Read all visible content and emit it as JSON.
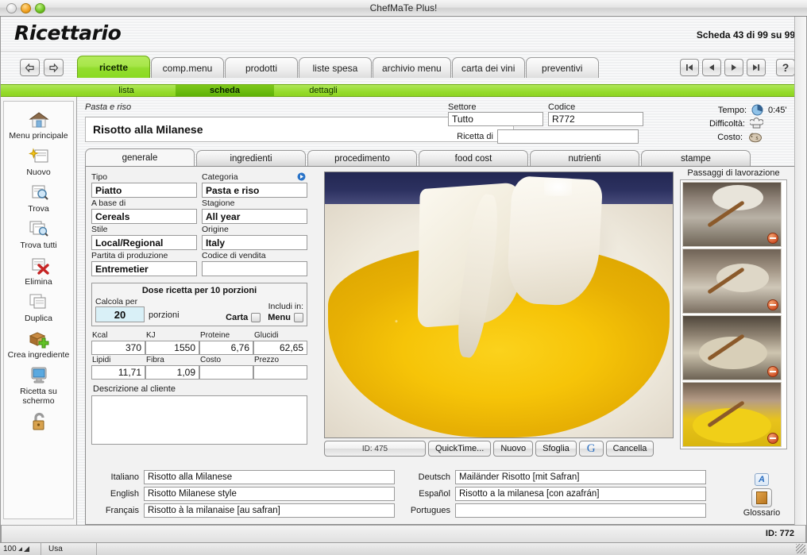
{
  "window": {
    "title": "ChefMaTe Plus!"
  },
  "header": {
    "app_title": "Ricettario",
    "record_info": "Scheda 43 di 99 su 99"
  },
  "nav": {
    "back_icon": "arrow-left-icon",
    "forward_icon": "arrow-right-icon",
    "tabs": [
      {
        "label": "ricette",
        "active": true
      },
      {
        "label": "comp.menu",
        "active": false
      },
      {
        "label": "prodotti",
        "active": false
      },
      {
        "label": "liste spesa",
        "active": false
      },
      {
        "label": "archivio menu",
        "active": false
      },
      {
        "label": "carta dei vini",
        "active": false
      },
      {
        "label": "preventivi",
        "active": false
      }
    ],
    "record_buttons": [
      "first-record-icon",
      "prev-record-icon",
      "next-record-icon",
      "last-record-icon"
    ],
    "help_label": "?"
  },
  "subnav": {
    "items": [
      {
        "label": "lista",
        "active": false
      },
      {
        "label": "scheda",
        "active": true
      },
      {
        "label": "dettagli",
        "active": false
      }
    ]
  },
  "sidebar": {
    "items": [
      {
        "label": "Menu principale",
        "icon": "home-icon"
      },
      {
        "label": "Nuovo",
        "icon": "new-record-icon"
      },
      {
        "label": "Trova",
        "icon": "find-icon"
      },
      {
        "label": "Trova tutti",
        "icon": "find-all-icon"
      },
      {
        "label": "Elimina",
        "icon": "delete-icon"
      },
      {
        "label": "Duplica",
        "icon": "duplicate-icon"
      },
      {
        "label": "Crea ingrediente",
        "icon": "add-ingredient-icon"
      },
      {
        "label": "Ricetta su schermo",
        "icon": "screen-recipe-icon"
      },
      {
        "label": "",
        "icon": "lock-icon"
      }
    ]
  },
  "recipe": {
    "category_breadcrumb": "Pasta e riso",
    "name": "Risotto alla Milanese",
    "settore_label": "Settore",
    "settore_value": "Tutto",
    "codice_label": "Codice",
    "codice_value": "R772",
    "ricetta_di_label": "Ricetta di",
    "ricetta_di_value": "",
    "tempo_label": "Tempo:",
    "tempo_value": "0:45'",
    "tempo_icon": "clock-icon",
    "difficolta_label": "Difficoltà:",
    "difficolta_icon": "chef-hat-icon",
    "costo_label": "Costo:",
    "costo_icon": "piggy-bank-icon"
  },
  "tabs": [
    {
      "label": "generale",
      "active": true
    },
    {
      "label": "ingredienti",
      "active": false
    },
    {
      "label": "procedimento",
      "active": false
    },
    {
      "label": "food cost",
      "active": false
    },
    {
      "label": "nutrienti",
      "active": false
    },
    {
      "label": "stampe",
      "active": false
    }
  ],
  "form": {
    "fields": [
      {
        "label": "Tipo",
        "value": "Piatto"
      },
      {
        "label": "Categoria",
        "value": "Pasta e riso",
        "has_arrow": true
      },
      {
        "label": "A base di",
        "value": "Cereals"
      },
      {
        "label": "Stagione",
        "value": "All year"
      },
      {
        "label": "Stile",
        "value": "Local/Regional"
      },
      {
        "label": "Origine",
        "value": "Italy"
      },
      {
        "label": "Partita di produzione",
        "value": "Entremetier"
      },
      {
        "label": "Codice di vendita",
        "value": ""
      }
    ],
    "dose": {
      "title": "Dose ricetta per 10 porzioni",
      "calcola_label": "Calcola per",
      "calcola_value": "20",
      "porzioni_label": "porzioni",
      "includi_label": "Includi in:",
      "carta_label": "Carta",
      "menu_label": "Menu"
    },
    "nutrition": [
      {
        "label": "Kcal",
        "value": "370"
      },
      {
        "label": "KJ",
        "value": "1550"
      },
      {
        "label": "Proteine",
        "value": "6,76"
      },
      {
        "label": "Glucidi",
        "value": "62,65"
      },
      {
        "label": "Lipidi",
        "value": "11,71"
      },
      {
        "label": "Fibra",
        "value": "1,09"
      },
      {
        "label": "Costo",
        "value": ""
      },
      {
        "label": "Prezzo",
        "value": ""
      }
    ],
    "description_label": "Descrizione al cliente",
    "description_value": ""
  },
  "photo": {
    "id_label": "ID: 475",
    "buttons": [
      "QuickTime...",
      "Nuovo",
      "Sfoglia",
      "G",
      "Cancella"
    ]
  },
  "passaggi": {
    "title": "Passaggi di lavorazione",
    "steps": [
      {
        "alt": "step-1-pouring-rice",
        "remove_icon": "remove-icon"
      },
      {
        "alt": "step-2-adding-rice",
        "remove_icon": "remove-icon"
      },
      {
        "alt": "step-3-stirring-rice",
        "remove_icon": "remove-icon"
      },
      {
        "alt": "step-4-saffron-risotto",
        "remove_icon": "remove-icon"
      }
    ]
  },
  "translations": {
    "left": [
      {
        "lang": "Italiano",
        "value": "Risotto alla Milanese"
      },
      {
        "lang": "English",
        "value": "Risotto Milanese style"
      },
      {
        "lang": "Français",
        "value": "Risotto à la milanaise [au safran]"
      }
    ],
    "right": [
      {
        "lang": "Deutsch",
        "value": "Mailänder Risotto [mit Safran]"
      },
      {
        "lang": "Español",
        "value": "Risotto a la milanesa [con azafrán]"
      },
      {
        "lang": "Portugues",
        "value": ""
      }
    ]
  },
  "glossary": {
    "font_button": "A",
    "label": "Glossario",
    "icon": "book-icon"
  },
  "footer": {
    "record_id": "ID: 772",
    "zoom_level": "100",
    "mode": "Usa"
  },
  "colors": {
    "accent_green": "#8ed420",
    "active_tab_green": "#93dd2e",
    "field_highlight": "#d9f0f7",
    "remove_red": "#d2552a"
  }
}
